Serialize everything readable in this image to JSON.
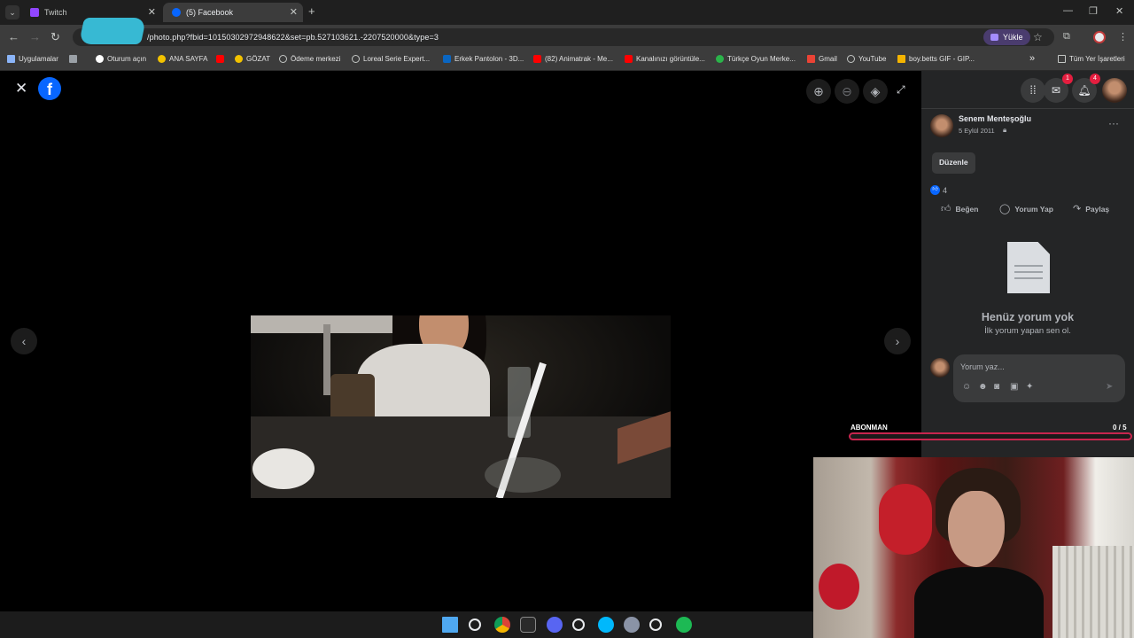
{
  "browser": {
    "tabs": [
      {
        "label": "Twitch",
        "active": false
      },
      {
        "label": "(5) Facebook",
        "active": true
      }
    ],
    "url": "/photo.php?fbid=10150302972948622&set=pb.527103621.-2207520000&type=3",
    "upload_label": "Yükle",
    "bookmarks": [
      {
        "label": "Uygulamalar",
        "icon": "apps-grid-icon"
      },
      {
        "label": "Oturum açın",
        "icon": "google-icon"
      },
      {
        "label": "ANA SAYFA",
        "icon": "smile-icon"
      },
      {
        "label": "",
        "icon": "youtube-icon"
      },
      {
        "label": "GÖZAT",
        "icon": "smile-icon"
      },
      {
        "label": "Ödeme merkezi",
        "icon": "globe-icon"
      },
      {
        "label": "Loreal Serie Expert...",
        "icon": "globe-icon"
      },
      {
        "label": "Erkek Pantolon - 3D...",
        "icon": "linkedin-icon"
      },
      {
        "label": "(82) Animatrak - Me...",
        "icon": "youtube-icon"
      },
      {
        "label": "Kanalınızı görüntüle...",
        "icon": "youtube-icon"
      },
      {
        "label": "Türkçe Oyun Merke...",
        "icon": "game-icon"
      },
      {
        "label": "Gmail",
        "icon": "gmail-icon"
      },
      {
        "label": "YouTube",
        "icon": "globe-icon"
      },
      {
        "label": "boy.betts GIF - GIP...",
        "icon": "doc-icon"
      }
    ],
    "all_bookmarks_label": "Tüm Yer İşaretleri",
    "more_bookmarks": "»"
  },
  "post": {
    "author": "Senem Menteşoğlu",
    "date": "5 Eylül 2011",
    "edit_label": "Düzenle",
    "reaction_count": "4",
    "actions": {
      "like": "Beğen",
      "comment": "Yorum Yap",
      "share": "Paylaş"
    },
    "empty_title": "Henüz yorum yok",
    "empty_subtitle": "İlk yorum yapan sen ol.",
    "comment_placeholder": "Yorum yaz..."
  },
  "header_badges": {
    "messenger": "1",
    "notifications": "4"
  },
  "overlay": {
    "subscriber_label": "ABONMAN",
    "subscriber_count": "0 / 5",
    "progress": 0
  },
  "colors": {
    "facebook_blue": "#0866ff",
    "panel_bg": "#242526",
    "badge_red": "#e41e3f",
    "overlay_red": "#c7254e"
  }
}
